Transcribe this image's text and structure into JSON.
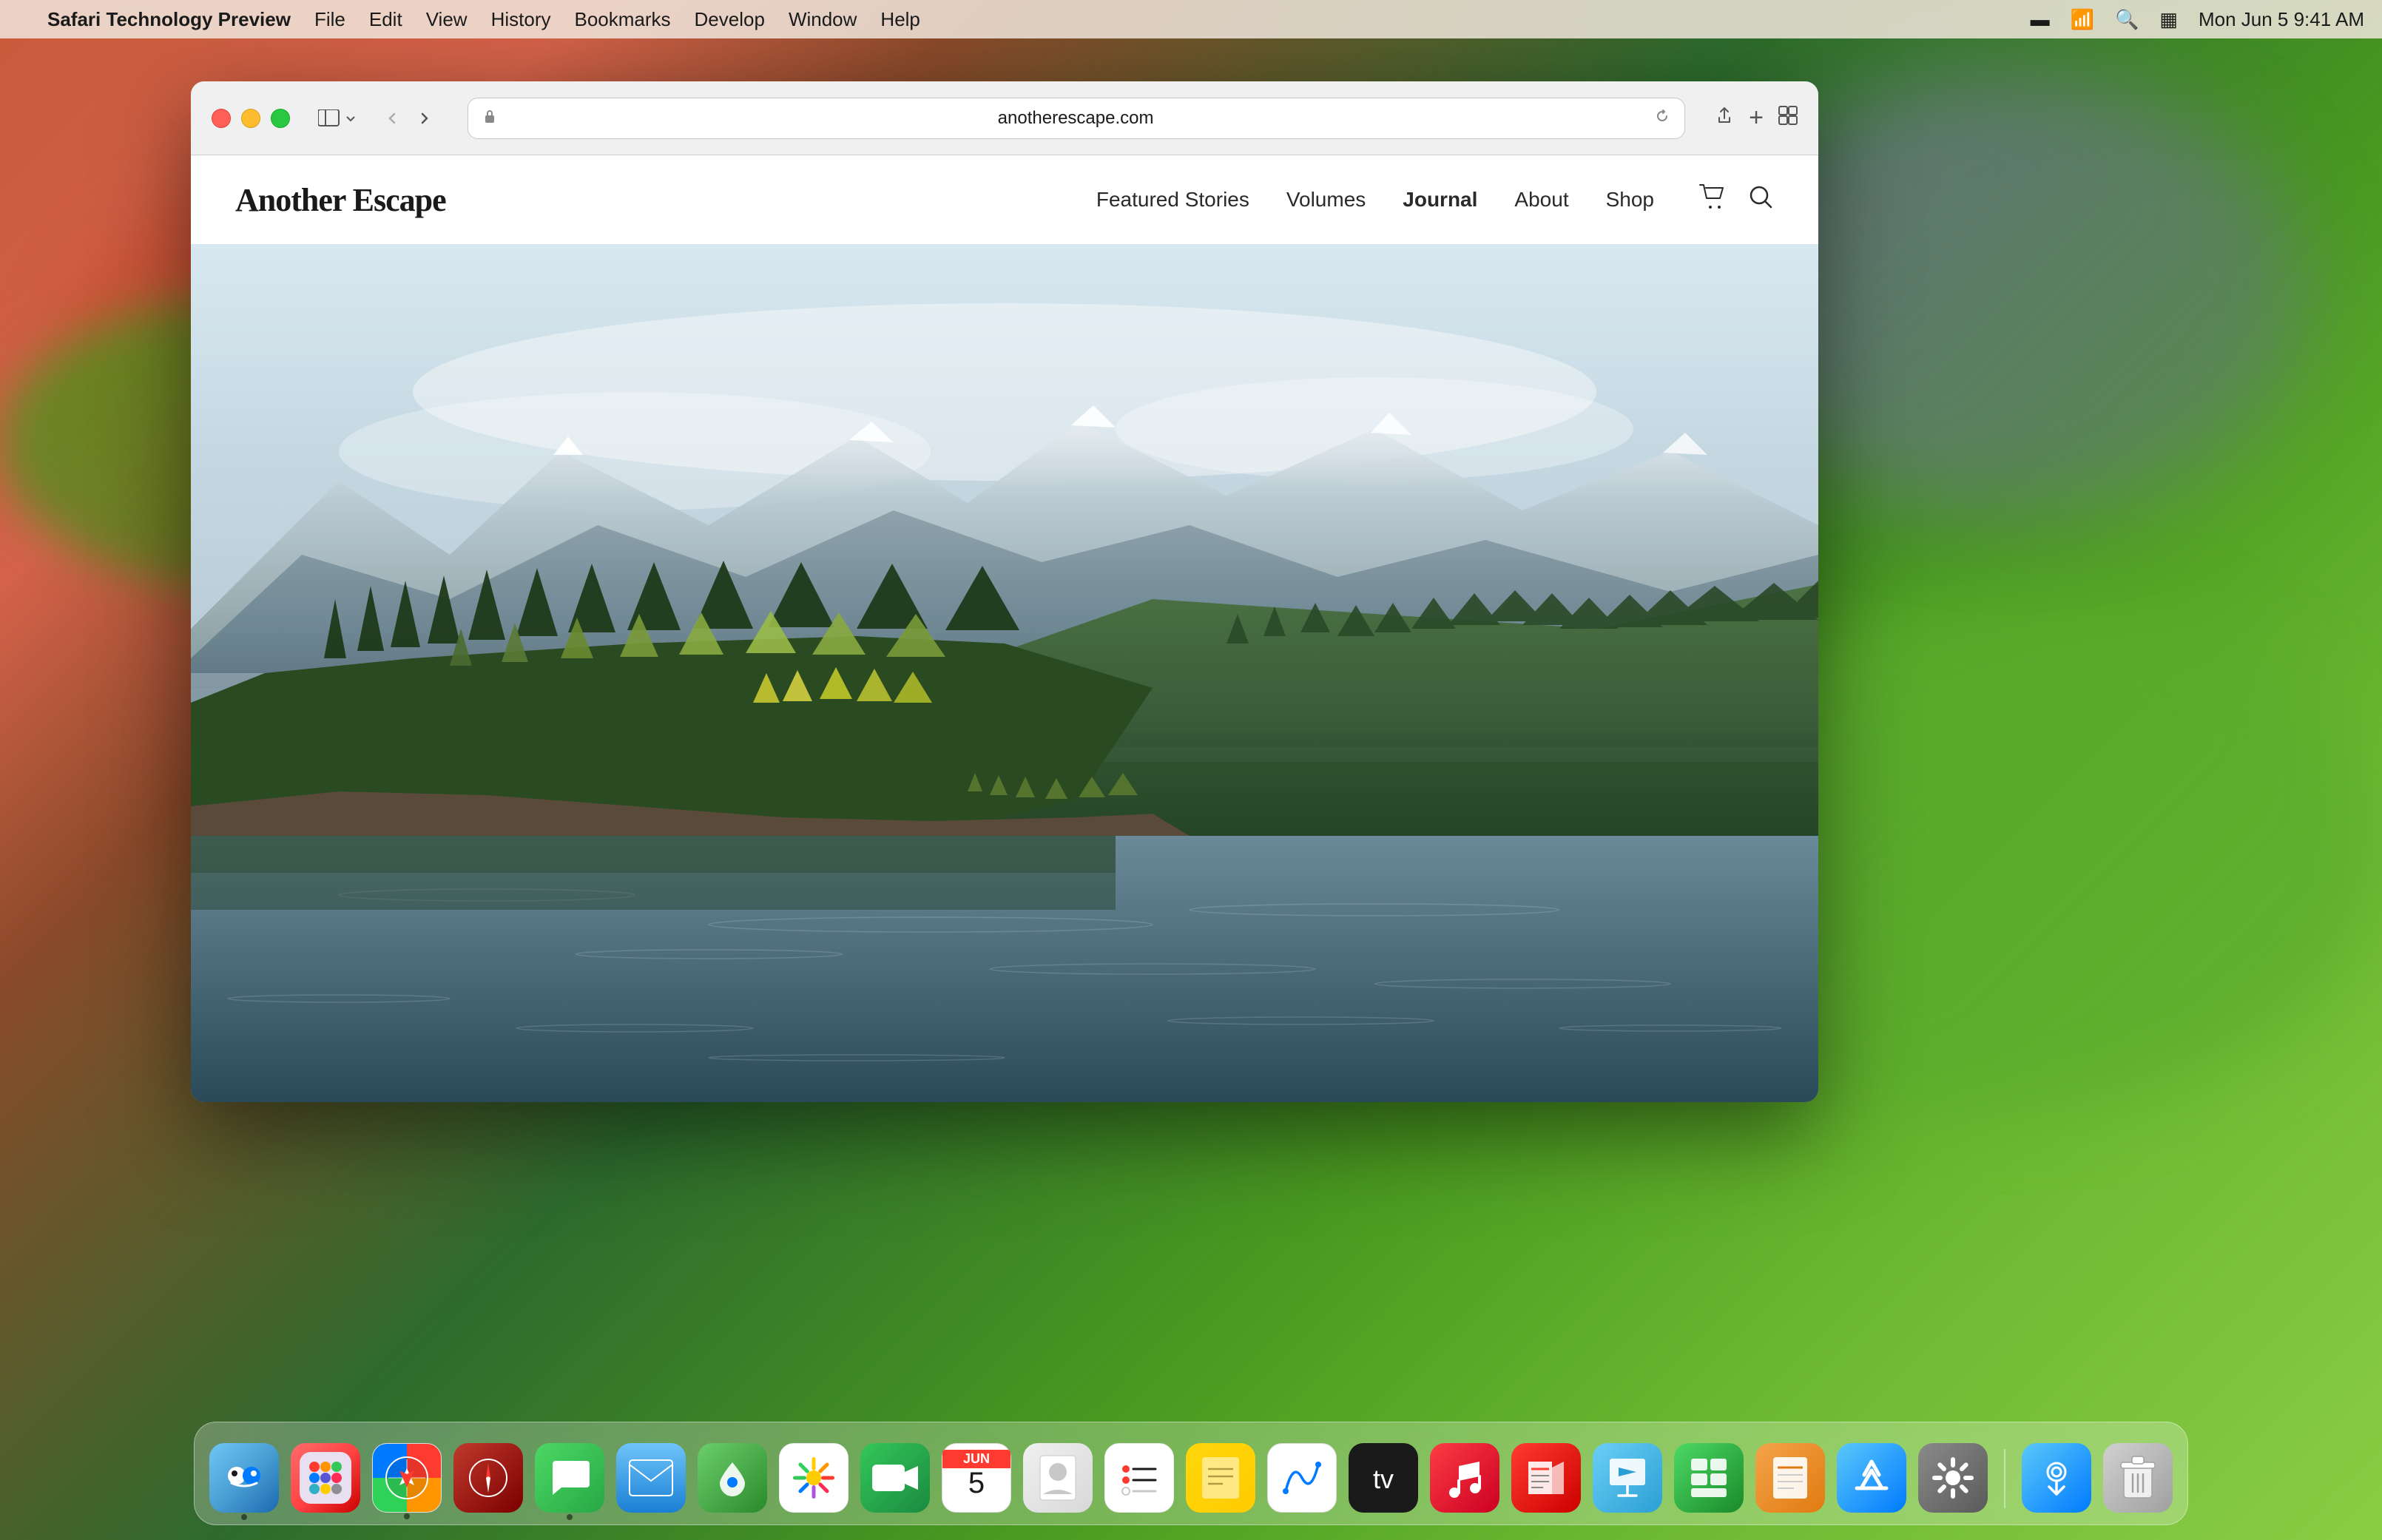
{
  "menubar": {
    "apple_label": "",
    "app_name": "Safari Technology Preview",
    "menus": [
      "File",
      "Edit",
      "View",
      "History",
      "Bookmarks",
      "Develop",
      "Window",
      "Help"
    ],
    "time": "Mon Jun 5  9:41 AM",
    "battery_icon": "battery-icon",
    "wifi_icon": "wifi-icon",
    "search_icon": "search-icon",
    "control_center_icon": "control-center-icon"
  },
  "browser": {
    "traffic_lights": {
      "red_label": "",
      "yellow_label": "",
      "green_label": ""
    },
    "sidebar_btn_label": "",
    "back_btn_label": "‹",
    "forward_btn_label": "›",
    "address": "anotherescape.com",
    "lock_icon": "lock-icon",
    "reload_icon": "reload-icon",
    "share_btn": "share-icon",
    "add_tab_btn": "+",
    "tabs_btn": "tabs-icon"
  },
  "website": {
    "logo": "Another Escape",
    "nav_links": [
      {
        "label": "Featured Stories",
        "bold": false
      },
      {
        "label": "Volumes",
        "bold": false
      },
      {
        "label": "Journal",
        "bold": true
      },
      {
        "label": "About",
        "bold": false
      },
      {
        "label": "Shop",
        "bold": false
      }
    ],
    "cart_icon": "cart-icon",
    "search_icon": "search-icon",
    "hero": {
      "description": "Scottish highland landscape with lake and pine forest against misty mountains"
    }
  },
  "dock": {
    "items": [
      {
        "name": "Finder",
        "icon": "finder",
        "has_dot": true
      },
      {
        "name": "Launchpad",
        "icon": "launchpad",
        "has_dot": false
      },
      {
        "name": "Safari",
        "icon": "safari",
        "has_dot": true
      },
      {
        "name": "Compass / Instruments",
        "icon": "compass",
        "has_dot": false
      },
      {
        "name": "Messages",
        "icon": "messages",
        "has_dot": true
      },
      {
        "name": "Mail",
        "icon": "mail",
        "has_dot": false
      },
      {
        "name": "Maps",
        "icon": "maps",
        "has_dot": false
      },
      {
        "name": "Photos",
        "icon": "photos",
        "has_dot": false
      },
      {
        "name": "FaceTime",
        "icon": "facetime",
        "has_dot": false
      },
      {
        "name": "Calendar",
        "icon": "calendar",
        "has_dot": false,
        "date_num": "5",
        "date_month": "JUN"
      },
      {
        "name": "Contacts",
        "icon": "contacts",
        "has_dot": false
      },
      {
        "name": "Reminders",
        "icon": "reminders",
        "has_dot": false
      },
      {
        "name": "Notes",
        "icon": "notes",
        "has_dot": false
      },
      {
        "name": "Freeform",
        "icon": "freeform",
        "has_dot": false
      },
      {
        "name": "Apple TV",
        "icon": "appletv",
        "has_dot": false
      },
      {
        "name": "Music",
        "icon": "music",
        "has_dot": false
      },
      {
        "name": "News",
        "icon": "news",
        "has_dot": false
      },
      {
        "name": "Keynote",
        "icon": "keynote",
        "has_dot": false
      },
      {
        "name": "Numbers",
        "icon": "numbers",
        "has_dot": false
      },
      {
        "name": "Pages",
        "icon": "pages",
        "has_dot": false
      },
      {
        "name": "App Store",
        "icon": "appstore",
        "has_dot": false
      },
      {
        "name": "System Preferences",
        "icon": "syspreferences",
        "has_dot": false
      },
      {
        "name": "AirDrop",
        "icon": "airdrop",
        "has_dot": false
      },
      {
        "name": "Trash",
        "icon": "trash",
        "has_dot": false
      }
    ]
  }
}
